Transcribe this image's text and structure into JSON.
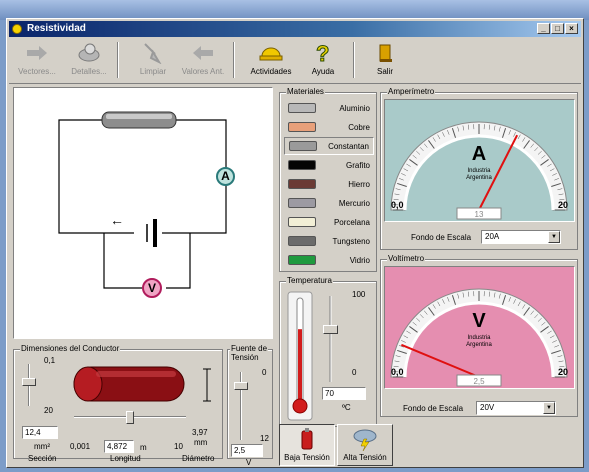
{
  "window": {
    "title": "Resistividad"
  },
  "toolbar": {
    "vectores": "Vectores...",
    "detalles": "Detalles...",
    "limpiar": "Limpiar",
    "valores": "Valores Ant.",
    "actividades": "Actividades",
    "ayuda": "Ayuda",
    "salir": "Salir"
  },
  "materials": {
    "label": "Materiales",
    "items": [
      {
        "name": "Aluminio",
        "color": "#b8b8b8"
      },
      {
        "name": "Cobre",
        "color": "#e8a07a"
      },
      {
        "name": "Constantan",
        "color": "#9a9a9a"
      },
      {
        "name": "Grafito",
        "color": "#050505"
      },
      {
        "name": "Hierro",
        "color": "#6a3a34"
      },
      {
        "name": "Mercurio",
        "color": "#9c9aa2"
      },
      {
        "name": "Porcelana",
        "color": "#f2efd6"
      },
      {
        "name": "Tungsteno",
        "color": "#6b6b6b"
      },
      {
        "name": "Vidrio",
        "color": "#1f9a3e"
      }
    ],
    "selected": "Constantan"
  },
  "ammeter": {
    "group": "Amperímetro",
    "letter": "A",
    "maker1": "Industria",
    "maker2": "Argentina",
    "min": "0,0",
    "max": "20",
    "reading": "13",
    "value": 13,
    "full_scale": 20,
    "scale_label": "Fondo de Escala",
    "scale_value": "20A",
    "face_color": "#a9cac9"
  },
  "voltmeter": {
    "group": "Voltímetro",
    "letter": "V",
    "maker1": "Industria",
    "maker2": "Argentina",
    "min": "0,0",
    "max": "20",
    "reading": "2,5",
    "value": 2.5,
    "full_scale": 20,
    "scale_label": "Fondo de Escala",
    "scale_value": "20V",
    "face_color": "#e58eb0"
  },
  "temperature": {
    "label": "Temperatura",
    "max": "100",
    "min": "0",
    "value": "70",
    "unit": "ºC"
  },
  "dimensions": {
    "label": "Dimensiones del Conductor",
    "section_max": "0,1",
    "section_min": "20",
    "section_value": "12,4",
    "section_unit": "mm²",
    "section_caption": "Sección",
    "length_min": "0,001",
    "length_value": "4,872",
    "length_unit": "m",
    "length_max": "10",
    "length_caption": "Longitud",
    "diameter_value": "3,97",
    "diameter_unit": "mm",
    "diameter_caption": "Diámetro"
  },
  "source": {
    "label1": "Fuente de",
    "label2": "Tensión",
    "max": "0",
    "min": "12",
    "value": "2,5",
    "unit": "V"
  },
  "modes": {
    "low": "Baja Tensión",
    "high": "Alta Tensión"
  },
  "circuit": {
    "ammeter_symbol": "A",
    "voltmeter_symbol": "V",
    "current_arrow": "←"
  }
}
